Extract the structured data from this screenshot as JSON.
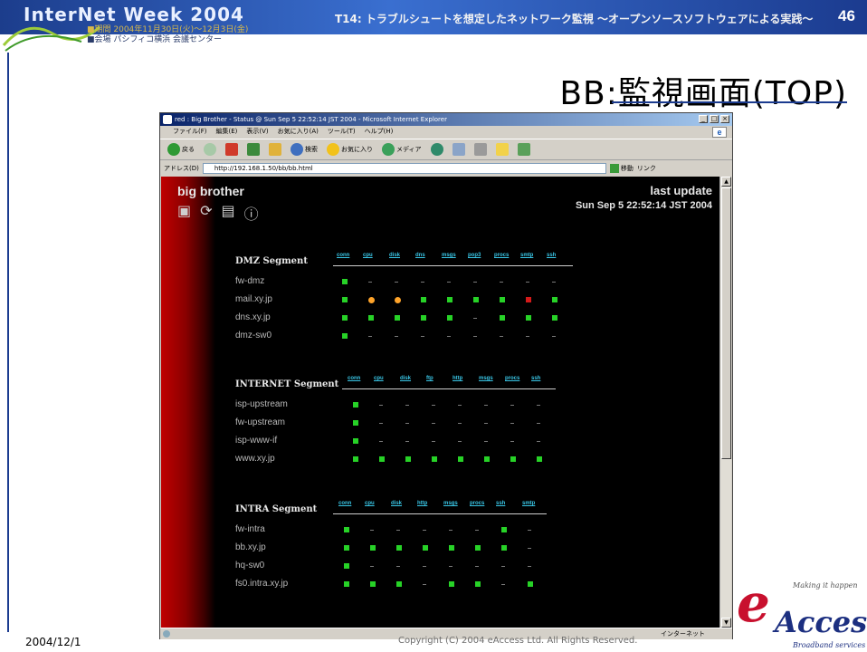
{
  "slide": {
    "event_name": "InterNet Week 2004",
    "event_line1": "■期間 2004年11月30日(火)〜12月3日(金)",
    "event_line2": "■会場 パシフィコ横浜 会議センター",
    "session": "T14: トラブルシュートを想定したネットワーク監視 〜オープンソースソフトウェアによる実践〜",
    "page_number": "46",
    "title": "BB:監視画面(TOP)",
    "footer_date": "2004/12/1",
    "footer_copy": "Copyright (C) 2004 eAccess Ltd. All Rights Reserved.",
    "logo_letter": "e",
    "logo_word": "Access",
    "logo_tag": "Making it happen",
    "logo_sub": "Broadband services",
    "colors": {
      "header_blue": "#1b3b8f",
      "bb_red": "#c00000",
      "ok": "#27d227",
      "warn": "#ffa42a",
      "alarm": "#d41a1a",
      "link": "#39c6e6"
    }
  },
  "browser": {
    "window_title": "red : Big Brother - Status @ Sun Sep 5 22:52:14 JST 2004 - Microsoft Internet Explorer",
    "window_controls": [
      "_",
      "□",
      "×"
    ],
    "menu": [
      "ファイル(F)",
      "編集(E)",
      "表示(V)",
      "お気に入り(A)",
      "ツール(T)",
      "ヘルプ(H)"
    ],
    "toolbar": [
      "戻る",
      "",
      "",
      "",
      "",
      "検索",
      "お気に入り",
      "メディア",
      "",
      "",
      "",
      "",
      ""
    ],
    "toolbar_icons": [
      "back-icon",
      "forward-icon",
      "stop-icon",
      "refresh-icon",
      "home-icon",
      "search-icon",
      "favorites-icon",
      "media-icon",
      "history-icon",
      "mail-icon",
      "print-icon",
      "edit-icon",
      "folder-icon"
    ],
    "address_label": "アドレス(D)",
    "address_value": "http://192.168.1.50/bb/bb.html",
    "go_label": "移動",
    "links_label": "リンク",
    "status_zone": "インターネット"
  },
  "bb": {
    "title": "big brother",
    "icons": [
      "bb-logo-icon",
      "refresh-cycle-icon",
      "report-icon",
      "info-icon"
    ],
    "last_update_label": "last update",
    "last_update_time": "Sun Sep 5 22:52:14 JST 2004",
    "segments": [
      {
        "name": "DMZ Segment",
        "columns": [
          "conn",
          "cpu",
          "disk",
          "dns",
          "msgs",
          "pop3",
          "procs",
          "smtp",
          "ssh"
        ],
        "hosts": [
          {
            "name": "fw-dmz",
            "status": [
              "g",
              "-",
              "-",
              "-",
              "-",
              "-",
              "-",
              "-",
              "-"
            ]
          },
          {
            "name": "mail.xy.jp",
            "status": [
              "g",
              "o",
              "o",
              "g",
              "g",
              "g",
              "g",
              "r",
              "g"
            ]
          },
          {
            "name": "dns.xy.jp",
            "status": [
              "g",
              "g",
              "g",
              "g",
              "g",
              "-",
              "g",
              "g",
              "g"
            ]
          },
          {
            "name": "dmz-sw0",
            "status": [
              "g",
              "-",
              "-",
              "-",
              "-",
              "-",
              "-",
              "-",
              "-"
            ]
          }
        ]
      },
      {
        "name": "INTERNET Segment",
        "columns": [
          "conn",
          "cpu",
          "disk",
          "ftp",
          "http",
          "msgs",
          "procs",
          "ssh"
        ],
        "hosts": [
          {
            "name": "isp-upstream",
            "status": [
              "g",
              "-",
              "-",
              "-",
              "-",
              "-",
              "-",
              "-"
            ]
          },
          {
            "name": "fw-upstream",
            "status": [
              "g",
              "-",
              "-",
              "-",
              "-",
              "-",
              "-",
              "-"
            ]
          },
          {
            "name": "isp-www-if",
            "status": [
              "g",
              "-",
              "-",
              "-",
              "-",
              "-",
              "-",
              "-"
            ]
          },
          {
            "name": "www.xy.jp",
            "status": [
              "g",
              "g",
              "g",
              "g",
              "g",
              "g",
              "g",
              "g"
            ]
          }
        ]
      },
      {
        "name": "INTRA Segment",
        "columns": [
          "conn",
          "cpu",
          "disk",
          "http",
          "msgs",
          "procs",
          "ssh",
          "smtp"
        ],
        "hosts": [
          {
            "name": "fw-intra",
            "status": [
              "g",
              "-",
              "-",
              "-",
              "-",
              "-",
              "g",
              "-"
            ]
          },
          {
            "name": "bb.xy.jp",
            "status": [
              "g",
              "g",
              "g",
              "g",
              "g",
              "g",
              "g",
              "-"
            ]
          },
          {
            "name": "hq-sw0",
            "status": [
              "g",
              "-",
              "-",
              "-",
              "-",
              "-",
              "-",
              "-"
            ]
          },
          {
            "name": "fs0.intra.xy.jp",
            "status": [
              "g",
              "g",
              "g",
              "-",
              "g",
              "g",
              "-",
              "g"
            ]
          }
        ]
      }
    ]
  }
}
